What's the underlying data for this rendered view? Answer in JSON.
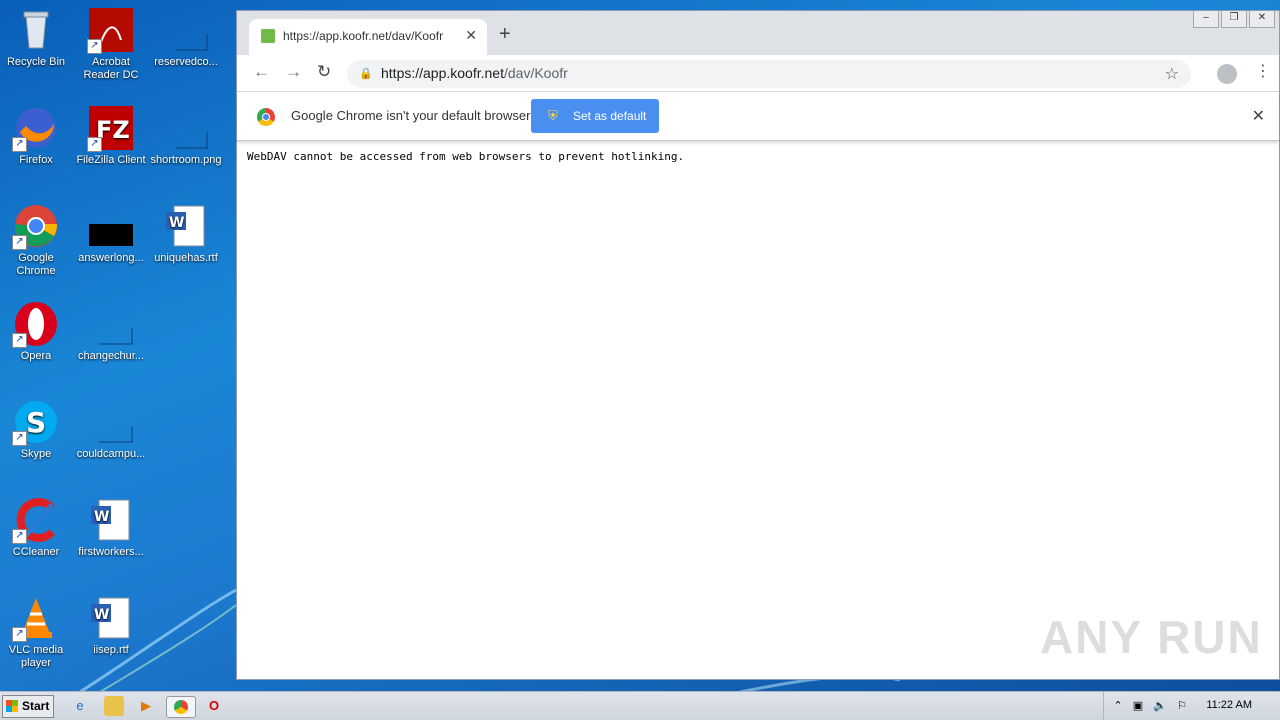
{
  "desktop": {
    "icons": [
      {
        "label": "Recycle Bin"
      },
      {
        "label": "Acrobat Reader DC"
      },
      {
        "label": "reservedco..."
      },
      {
        "label": "Firefox"
      },
      {
        "label": "FileZilla Client"
      },
      {
        "label": "shortroom.png"
      },
      {
        "label": "Google Chrome"
      },
      {
        "label": "answerlong..."
      },
      {
        "label": "uniquehas.rtf"
      },
      {
        "label": "Opera"
      },
      {
        "label": "changechur..."
      },
      {
        "label": "Skype"
      },
      {
        "label": "couldcampu..."
      },
      {
        "label": "CCleaner"
      },
      {
        "label": "firstworkers..."
      },
      {
        "label": "VLC media player"
      },
      {
        "label": "iisep.rtf"
      }
    ]
  },
  "browser": {
    "tab_title": "https://app.koofr.net/dav/Koofr",
    "url_host": "https://app.koofr.net",
    "url_path": "/dav/Koofr",
    "infobar_text": "Google Chrome isn't your default browser",
    "set_default_label": "Set as default",
    "page_text": "WebDAV cannot be accessed from web browsers to prevent hotlinking."
  },
  "watermark": "ANY RUN",
  "taskbar": {
    "start_label": "Start",
    "clock": "11:22 AM"
  },
  "colors": {
    "desktop_blue": "#1a86d6",
    "set_default_button": "#4a8ff0",
    "tab_favicon": "#6fba4b"
  }
}
